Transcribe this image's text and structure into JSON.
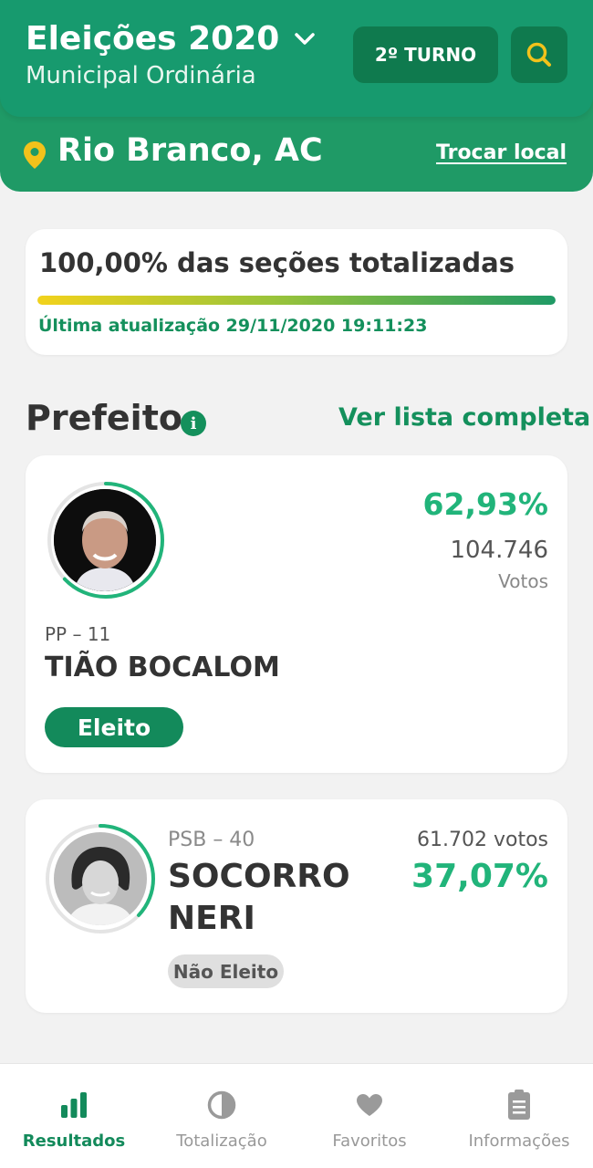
{
  "header": {
    "title": "Eleições 2020",
    "subtitle": "Municipal Ordinária",
    "turno_label": "2º TURNO",
    "location": "Rio Branco, AC",
    "change_location": "Trocar local"
  },
  "progress": {
    "title": "100,00% das seções totalizadas",
    "fraction": 1.0,
    "last_update": "Última atualização 29/11/2020 19:11:23"
  },
  "section": {
    "title": "Prefeito",
    "see_all": "Ver lista completa"
  },
  "candidates": [
    {
      "party": "PP – 11",
      "name": "TIÃO BOCALOM",
      "percent": "62,93%",
      "percent_value": 62.93,
      "votes": "104.746",
      "votes_label": "Votos",
      "status": "Eleito"
    },
    {
      "party": "PSB – 40",
      "name_line1": "SOCORRO",
      "name_line2": "NERI",
      "percent": "37,07%",
      "percent_value": 37.07,
      "votes": "61.702 votos",
      "status": "Não Eleito"
    }
  ],
  "nav": [
    {
      "label": "Resultados",
      "icon": "bar-chart-icon",
      "active": true
    },
    {
      "label": "Totalização",
      "icon": "pie-chart-icon",
      "active": false
    },
    {
      "label": "Favoritos",
      "icon": "heart-icon",
      "active": false
    },
    {
      "label": "Informações",
      "icon": "clipboard-icon",
      "active": false
    }
  ],
  "colors": {
    "primary": "#1f9a66",
    "accent_green": "#21b47a",
    "search_icon": "#f2c21b",
    "pin_icon": "#f2c21b"
  }
}
